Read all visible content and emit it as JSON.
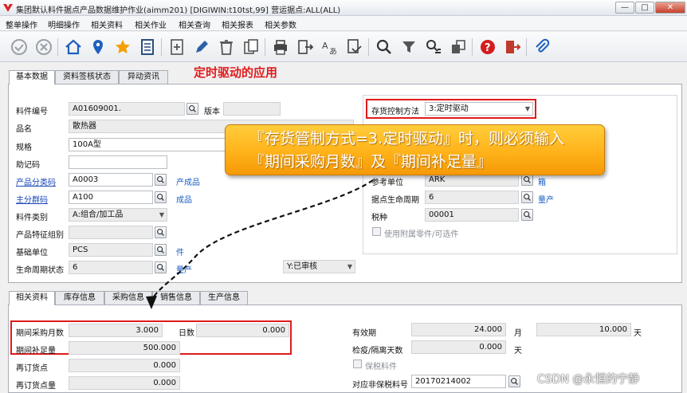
{
  "window": {
    "title": "集团默认料件据点产品数据维护作业(aimm201)    [DIGIWIN:t10tst,99]    营运据点:ALL(ALL)",
    "buttons": {
      "minimize": "—",
      "maximize": "□",
      "close": "✕"
    }
  },
  "menu": [
    "整单操作",
    "明细操作",
    "相关资料",
    "相关作业",
    "相关查询",
    "相关报表",
    "相关参数"
  ],
  "toolbar": {
    "icons": [
      "check-icon",
      "cancel-icon",
      "home-icon",
      "location-pin-icon",
      "star-icon",
      "list-icon",
      "add-icon",
      "edit-icon",
      "delete-icon",
      "copy-icon",
      "print-icon",
      "export-icon",
      "translate-icon",
      "convert-icon",
      "search-icon",
      "filter-icon",
      "query-icon",
      "layout-icon",
      "help-icon",
      "exit-icon",
      "attachment-icon"
    ],
    "accent": "#1f5fbf"
  },
  "heading": "定时驱动的应用",
  "top_tabs": [
    "基本数据",
    "资料签核状态",
    "异动资讯"
  ],
  "basic": {
    "item_no_label": "料件编号",
    "item_no": "A01609001.",
    "version_label": "版本",
    "version": "",
    "name_label": "品名",
    "name": "散热器",
    "spec_label": "规格",
    "spec": "100A型",
    "mnemonic_label": "助记码",
    "mnemonic": "",
    "category_label": "产品分类码",
    "category": "A0003",
    "category_desc": "产成品",
    "main_group_label": "主分群码",
    "main_group": "A100",
    "main_group_desc": "成品",
    "item_type_label": "料件类别",
    "item_type": "A:组合/加工品",
    "feature_group_label": "产品特征组别",
    "feature_group": "",
    "base_unit_label": "基础单位",
    "base_unit": "PCS",
    "base_unit_desc": "件",
    "lifecycle_label": "生命周期状态",
    "lifecycle": "6",
    "lifecycle_desc": "量产",
    "status": "Y:已审核"
  },
  "right": {
    "inv_method_label": "存货控制方法",
    "inv_method": "3:定时驱动",
    "ref_unit_label": "参考单位",
    "ref_unit": "ARK",
    "ref_unit_desc": "箱",
    "site_lifecycle_label": "据点生命周期",
    "site_lifecycle": "6",
    "site_lifecycle_desc": "量产",
    "tax_label": "税种",
    "tax": "00001",
    "use_attached_label": "使用附属零件/可选件"
  },
  "callout": "『存货管制方式=3.定时驱动』时，则必须输入\n『期间采购月数』及『期间补足量』",
  "bottom_tabs": [
    "相关资料",
    "库存信息",
    "采购信息",
    "销售信息",
    "生产信息"
  ],
  "bottom": {
    "period_months_label": "期间采购月数",
    "period_months": "3.000",
    "days_label": "日数",
    "days": "0.000",
    "replenish_label": "期间补足量",
    "replenish": "500.000",
    "reorder_label": "再订货点",
    "reorder": "0.000",
    "reorder_qty_label": "再订货点量",
    "reorder_qty": "0.000",
    "valid_label": "有效期",
    "valid": "24.000",
    "valid_unit": "月",
    "valid2": "10.000",
    "valid2_unit": "天",
    "quarantine_label": "检疫/隔离天数",
    "quarantine": "0.000",
    "quarantine_unit": "天",
    "bonded_label": "保税料件",
    "nonbonded_label": "对应非保税料号",
    "nonbonded": "20170214002"
  },
  "watermark": "CSDN @永恒的宁静",
  "colors": {
    "highlight": "#e01b1b",
    "callout": "#ffb21a",
    "link": "#1a46b8"
  }
}
